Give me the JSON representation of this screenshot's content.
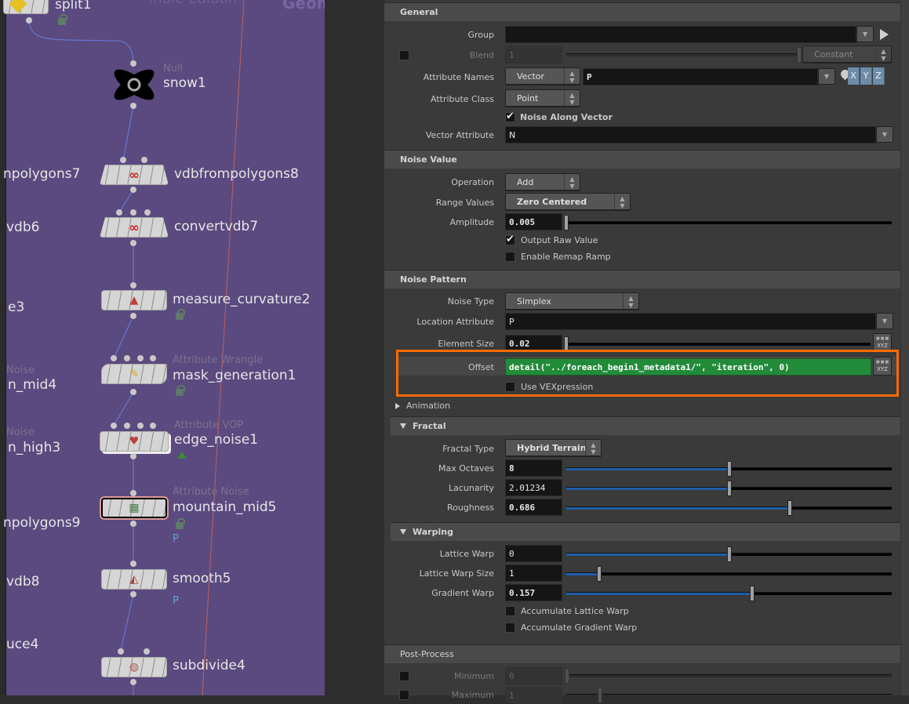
{
  "network": {
    "background_labels": {
      "edition": "Indie Edition",
      "context": "Geometry"
    },
    "nodes": [
      {
        "name": "split1",
        "type": "",
        "icon": "split-icon",
        "flags": [
          "lock"
        ]
      },
      {
        "name": "snow1",
        "type": "Null",
        "icon": "null-icon",
        "flags": []
      },
      {
        "name": "vdbfrompolygons8",
        "type": "",
        "icon": "vdb-icon",
        "flags": []
      },
      {
        "name": "convertvdb7",
        "type": "",
        "icon": "vdb-icon",
        "flags": []
      },
      {
        "name": "measure_curvature2",
        "type": "",
        "icon": "measure-icon",
        "flags": [
          "lock"
        ]
      },
      {
        "name": "mask_generation1",
        "type": "Attribute Wrangle",
        "icon": "wrangle-icon",
        "flags": [
          "lock"
        ]
      },
      {
        "name": "edge_noise1",
        "type": "Attribute VOP",
        "icon": "vop-icon",
        "flags": [
          "bypass-down"
        ]
      },
      {
        "name": "mountain_mid5",
        "type": "Attribute Noise",
        "icon": "noise-icon",
        "flags": [
          "lock",
          "P"
        ],
        "selected": true
      },
      {
        "name": "smooth5",
        "type": "",
        "icon": "smooth-icon",
        "flags": [
          "P"
        ]
      },
      {
        "name": "subdivide4",
        "type": "",
        "icon": "subdivide-icon",
        "flags": []
      }
    ],
    "side_labels": [
      {
        "text": "npolygons7"
      },
      {
        "text": "vdb6"
      },
      {
        "text": "e3"
      },
      {
        "type": "Noise",
        "text": "n_mid4"
      },
      {
        "type": "Noise",
        "text": "n_high3"
      },
      {
        "text": "npolygons9"
      },
      {
        "text": "vdb8"
      },
      {
        "text": "uce4"
      }
    ],
    "flag_P": "P"
  },
  "params": {
    "general": {
      "title": "General",
      "group_label": "Group",
      "group_value": "",
      "blend_label": "Blend",
      "blend_value": "1",
      "blend_mode": "Constant",
      "attr_names_label": "Attribute Names",
      "attr_names_type": "Vector",
      "attr_names_value": "P",
      "xyz": [
        "X",
        "Y",
        "Z"
      ],
      "attr_class_label": "Attribute Class",
      "attr_class_value": "Point",
      "noise_along_vector_label": "Noise Along Vector",
      "noise_along_vector": true,
      "vector_attr_label": "Vector Attribute",
      "vector_attr_value": "N"
    },
    "noise_value": {
      "title": "Noise Value",
      "operation_label": "Operation",
      "operation_value": "Add",
      "range_label": "Range Values",
      "range_value": "Zero Centered",
      "amplitude_label": "Amplitude",
      "amplitude_value": "0.005",
      "amplitude_fraction": 0.0,
      "output_raw_label": "Output Raw Value",
      "output_raw": true,
      "remap_label": "Enable Remap Ramp",
      "remap": false
    },
    "noise_pattern": {
      "title": "Noise Pattern",
      "noise_type_label": "Noise Type",
      "noise_type_value": "Simplex",
      "location_label": "Location Attribute",
      "location_value": "P",
      "element_size_label": "Element Size",
      "element_size_value": "0.02",
      "element_size_fraction": 0.0,
      "offset_label": "Offset",
      "offset_value": "detail(\"../foreach_begin1_metadata1/\", \"iteration\", 0)",
      "vexpr_label": "Use VEXpression",
      "vexpr": false
    },
    "animation": {
      "title": "Animation"
    },
    "fractal": {
      "title": "Fractal",
      "type_label": "Fractal Type",
      "type_value": "Hybrid Terrain",
      "octaves_label": "Max Octaves",
      "octaves_value": "8",
      "octaves_fraction": 0.5,
      "lacunarity_label": "Lacunarity",
      "lacunarity_value": "2.01234",
      "lacunarity_fraction": 0.5,
      "roughness_label": "Roughness",
      "roughness_value": "0.686",
      "roughness_fraction": 0.686
    },
    "warping": {
      "title": "Warping",
      "lattice_label": "Lattice Warp",
      "lattice_value": "0",
      "lattice_fraction": 0.5,
      "lattice_size_label": "Lattice Warp Size",
      "lattice_size_value": "1",
      "lattice_size_fraction": 0.1,
      "gradient_label": "Gradient Warp",
      "gradient_value": "0.157",
      "gradient_fraction": 0.57,
      "acc_lattice_label": "Accumulate Lattice Warp",
      "acc_lattice": false,
      "acc_gradient_label": "Accumulate Gradient Warp",
      "acc_gradient": false
    },
    "post_process": {
      "title": "Post-Process",
      "min_label": "Minimum",
      "min_value": "0",
      "max_label": "Maximum",
      "max_value": "1"
    }
  },
  "colors": {
    "network_bg": "#5a4a7f",
    "highlight": "#ff6a00",
    "expression_bg": "#228b3a",
    "slider_fill": "#1e5fa8"
  }
}
